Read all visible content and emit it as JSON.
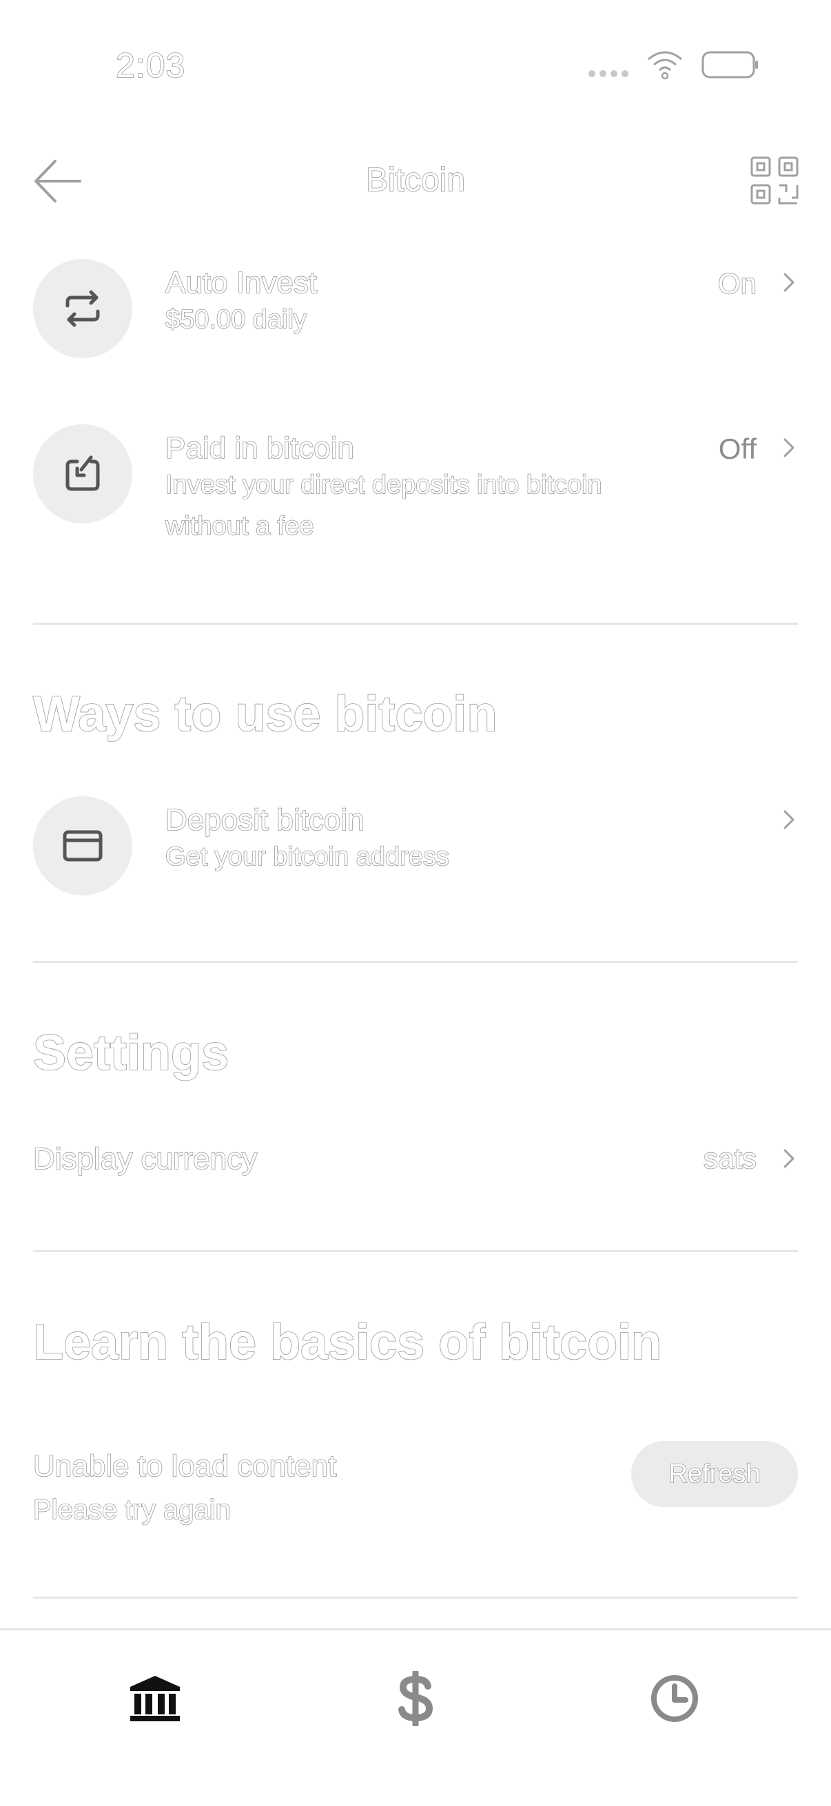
{
  "status_bar": {
    "time": "2:03"
  },
  "header": {
    "title": "Bitcoin"
  },
  "auto_invest": {
    "title": "Auto Invest",
    "subtitle": "$50.00 daily",
    "value": "On"
  },
  "paid_in_bitcoin": {
    "title": "Paid in bitcoin",
    "subtitle_line1": "Invest your direct deposits into bitcoin",
    "subtitle_line2": "without a fee",
    "value": "Off"
  },
  "ways_section": {
    "heading": "Ways to use bitcoin"
  },
  "deposit_bitcoin": {
    "title": "Deposit bitcoin",
    "subtitle": "Get your bitcoin address"
  },
  "settings_section": {
    "heading": "Settings"
  },
  "display_currency": {
    "label": "Display currency",
    "value": "sats"
  },
  "learn_section": {
    "heading": "Learn the basics of bitcoin",
    "error_title": "Unable to load content",
    "error_subtitle": "Please try again",
    "refresh_label": "Refresh"
  },
  "bottom_nav": {
    "items": [
      {
        "icon": "bank-icon",
        "active": true
      },
      {
        "icon": "dollar-icon",
        "active": false
      },
      {
        "icon": "clock-icon",
        "active": false
      }
    ]
  },
  "colors": {
    "accent": "#000000",
    "muted": "#8c8c8c",
    "icon_bg": "#ededed"
  }
}
